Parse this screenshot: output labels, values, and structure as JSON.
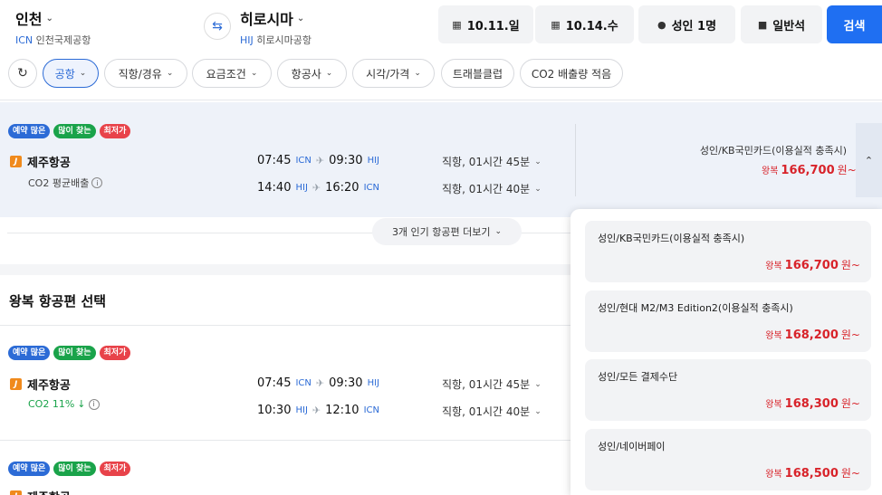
{
  "header": {
    "origin": {
      "city": "인천",
      "code": "ICN",
      "airport": "인천국제공항"
    },
    "destination": {
      "city": "히로시마",
      "code": "HIJ",
      "airport": "히로시마공항"
    },
    "depart_date": "10.11.일",
    "return_date": "10.14.수",
    "passengers": "성인 1명",
    "seat_class": "일반석",
    "search_label": "검색"
  },
  "filters": [
    "공항",
    "직항/경유",
    "요금조건",
    "항공사",
    "시각/가격",
    "트래블클럽",
    "CO2 배출량 적음"
  ],
  "featured": {
    "badges": [
      "예약 많은",
      "많이 찾는",
      "최저가"
    ],
    "airline": "제주항공",
    "co2": "CO2 평균배출",
    "outbound": {
      "dep": "07:45",
      "dep_code": "ICN",
      "arr": "09:30",
      "arr_code": "HIJ",
      "duration": "직항, 01시간 45분"
    },
    "inbound": {
      "dep": "14:40",
      "dep_code": "HIJ",
      "arr": "16:20",
      "arr_code": "ICN",
      "duration": "직항, 01시간 40분"
    },
    "price_label": "성인/KB국민카드(이용실적 충족시)",
    "price_prefix": "왕복",
    "price": "166,700",
    "price_suffix": "원~"
  },
  "more_button": "3개 인기 항공편 더보기",
  "section_title": "왕복 항공편 선택",
  "results": [
    {
      "badges": [
        "예약 많은",
        "많이 찾는",
        "최저가"
      ],
      "airline": "제주항공",
      "co2": "CO2 11%",
      "outbound": {
        "dep": "07:45",
        "dep_code": "ICN",
        "arr": "09:30",
        "arr_code": "HIJ",
        "duration": "직항, 01시간 45분"
      },
      "inbound": {
        "dep": "10:30",
        "dep_code": "HIJ",
        "arr": "12:10",
        "arr_code": "ICN",
        "duration": "직항, 01시간 40분"
      }
    },
    {
      "badges": [
        "예약 많은",
        "많이 찾는",
        "최저가"
      ],
      "airline": "제주항공"
    }
  ],
  "price_popup": [
    {
      "label": "성인/KB국민카드(이용실적 충족시)",
      "prefix": "왕복",
      "price": "166,700",
      "suffix": "원~"
    },
    {
      "label": "성인/현대 M2/M3 Edition2(이용실적 충족시)",
      "prefix": "왕복",
      "price": "168,200",
      "suffix": "원~"
    },
    {
      "label": "성인/모든 결제수단",
      "prefix": "왕복",
      "price": "168,300",
      "suffix": "원~"
    },
    {
      "label": "성인/네이버페이",
      "prefix": "왕복",
      "price": "168,500",
      "suffix": "원~"
    }
  ],
  "colors": {
    "accent": "#1f6ff2",
    "price": "#d8232a",
    "badge_blue": "#2c6bd6",
    "badge_green": "#1aa34a",
    "badge_red": "#e8434a"
  }
}
